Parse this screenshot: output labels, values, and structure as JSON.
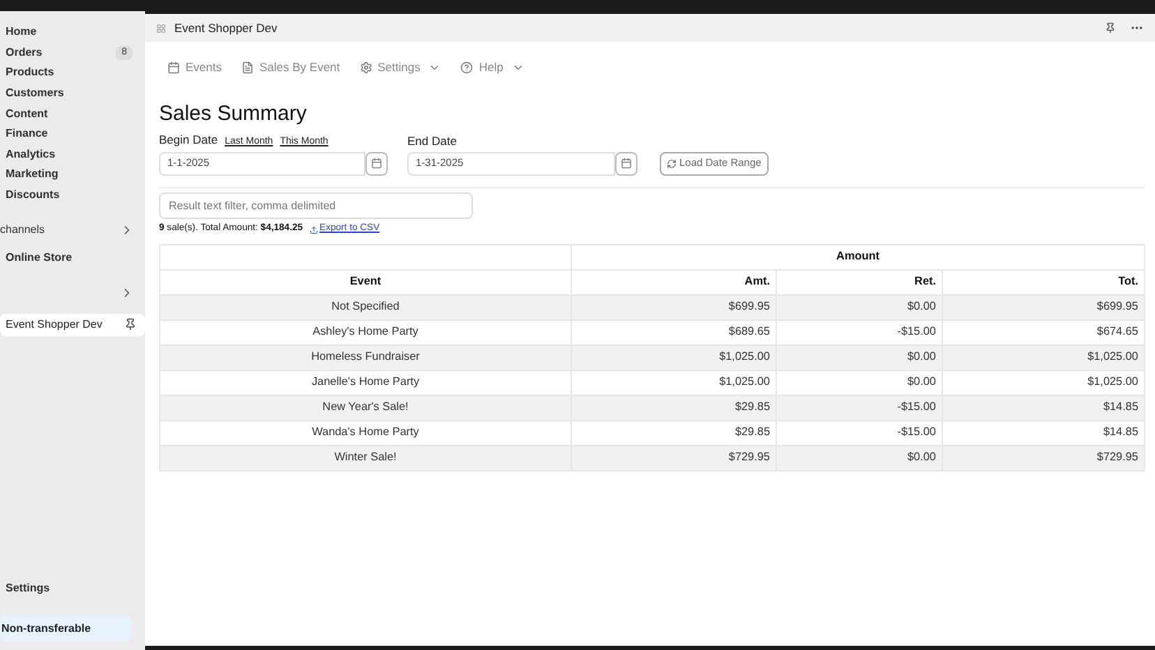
{
  "sidebar": {
    "items": [
      {
        "kind": "item",
        "label": "Home",
        "selected": false
      },
      {
        "kind": "item",
        "label": "Orders",
        "badge": "8",
        "selected": false
      },
      {
        "kind": "item",
        "label": "Products",
        "selected": false
      },
      {
        "kind": "item",
        "label": "Customers",
        "selected": false
      },
      {
        "kind": "item",
        "label": "Content",
        "selected": false
      },
      {
        "kind": "item",
        "label": "Finance",
        "selected": false
      },
      {
        "kind": "item",
        "label": "Analytics",
        "selected": false
      },
      {
        "kind": "item",
        "label": "Marketing",
        "selected": false
      },
      {
        "kind": "item",
        "label": "Discounts",
        "selected": false
      },
      {
        "kind": "section",
        "label": "channels"
      },
      {
        "kind": "item",
        "label": "Online Store",
        "selected": false
      },
      {
        "kind": "section"
      },
      {
        "kind": "app",
        "label": "Event Shopper Dev",
        "selected": true
      }
    ],
    "settings": "Settings",
    "plan": "Non-transferable"
  },
  "header": {
    "title": "Event Shopper Dev"
  },
  "nav": [
    {
      "kind": "events",
      "label": "Events",
      "dropdown": false
    },
    {
      "kind": "sales",
      "label": "Sales By Event",
      "dropdown": false
    },
    {
      "kind": "settings",
      "label": "Settings",
      "dropdown": true
    },
    {
      "kind": "help",
      "label": "Help",
      "dropdown": true
    }
  ],
  "title": "Sales Summary",
  "begin_date": {
    "label": "Begin Date",
    "links": [
      "Last Month",
      "This Month"
    ],
    "value": "1-1-2025"
  },
  "end_date": {
    "label": "End Date",
    "value": "1-31-2025"
  },
  "load_button": "Load Date Range",
  "filter": {
    "placeholder": "Result text filter, comma delimited"
  },
  "summary": {
    "text": "**9** sale(s). Total Amount: **$4,184.25**",
    "export": "Export to CSV"
  },
  "table": {
    "group": "Amount",
    "columns": [
      "Event",
      "Amt.",
      "Ret.",
      "Tot."
    ],
    "rows": [
      [
        "Not Specified",
        "$699.95",
        "$0.00",
        "$699.95"
      ],
      [
        "Ashley's Home Party",
        "$689.65",
        "-$15.00",
        "$674.65"
      ],
      [
        "Homeless Fundraiser",
        "$1,025.00",
        "$0.00",
        "$1,025.00"
      ],
      [
        "Janelle's Home Party",
        "$1,025.00",
        "$0.00",
        "$1,025.00"
      ],
      [
        "New Year's Sale!",
        "$29.85",
        "-$15.00",
        "$14.85"
      ],
      [
        "Wanda's Home Party",
        "$29.85",
        "-$15.00",
        "$14.85"
      ],
      [
        "Winter Sale!",
        "$729.95",
        "$0.00",
        "$729.95"
      ]
    ]
  }
}
